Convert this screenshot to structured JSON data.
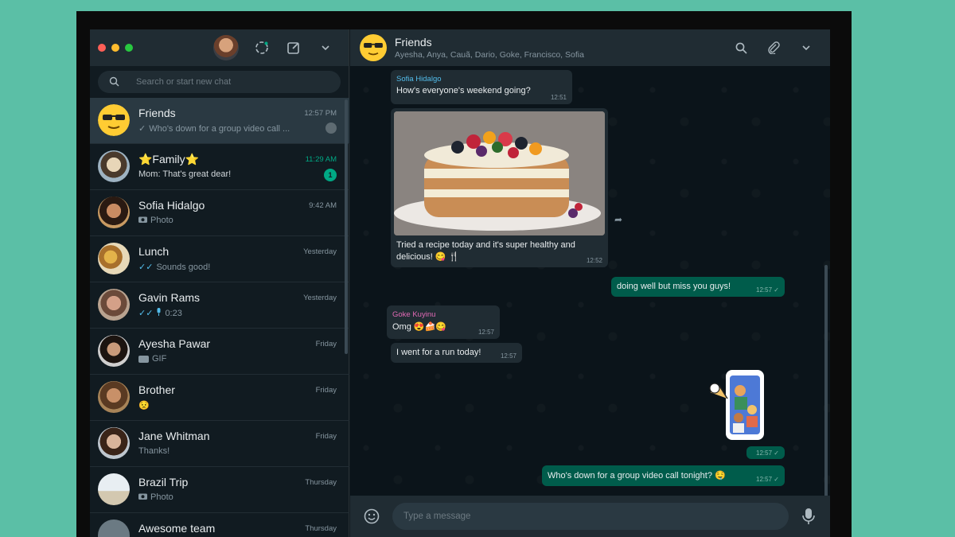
{
  "sidebar": {
    "search_placeholder": "Search or start new chat",
    "chats": [
      {
        "name": "Friends",
        "time": "12:57 PM",
        "preview": "Who's down for a group video call ...",
        "status": "sent-check",
        "pinned": true,
        "active": true
      },
      {
        "name": "⭐Family⭐",
        "time": "11:29 AM",
        "preview": "Mom: That's great dear!",
        "unread": "1",
        "time_highlight": true
      },
      {
        "name": "Sofia Hidalgo",
        "time": "9:42 AM",
        "preview": "Photo",
        "status": "camera-icon"
      },
      {
        "name": "Lunch",
        "time": "Yesterday",
        "preview": "Sounds good!",
        "status": "read-check"
      },
      {
        "name": "Gavin Rams",
        "time": "Yesterday",
        "preview": "0:23",
        "status": "read-check mic-icon"
      },
      {
        "name": "Ayesha Pawar",
        "time": "Friday",
        "preview": "GIF",
        "status": "gif-icon"
      },
      {
        "name": "Brother",
        "time": "Friday",
        "preview": "😟"
      },
      {
        "name": "Jane Whitman",
        "time": "Friday",
        "preview": "Thanks!"
      },
      {
        "name": "Brazil Trip",
        "time": "Thursday",
        "preview": "Photo",
        "status": "camera-icon"
      },
      {
        "name": "Awesome team",
        "time": "Thursday",
        "preview": ""
      }
    ]
  },
  "conversation": {
    "title": "Friends",
    "members": "Ayesha, Anya, Cauã, Dario, Goke, Francisco, Sofia",
    "input_placeholder": "Type a message",
    "messages": {
      "m1": {
        "sender": "Sofia Hidalgo",
        "text": "How's everyone's weekend going?",
        "time": "12:51"
      },
      "m2": {
        "text": "Tried a recipe today and it's super healthy and delicious! 😋 🍴",
        "time": "12:52"
      },
      "m3": {
        "text": "doing well but miss you guys!",
        "time": "12:57"
      },
      "m4": {
        "sender": "Goke Kuyinu",
        "text": "Omg 😍🍰😋",
        "time": "12:57"
      },
      "m5": {
        "text": "I went for a run today!",
        "time": "12:57"
      },
      "m6": {
        "time": "12:57"
      },
      "m7": {
        "text": "Who's down for a group video call tonight? 🤤",
        "time": "12:57"
      }
    }
  },
  "colors": {
    "accent": "#00a884",
    "sofia_name": "#53bdeb",
    "goke_name": "#e26ab6"
  }
}
